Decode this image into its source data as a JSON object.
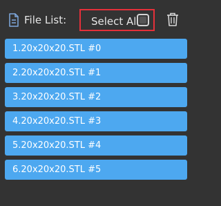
{
  "header": {
    "title": "File List:",
    "file_icon": "file-text-icon",
    "select_all_label": "Select All",
    "select_all_checked": false,
    "delete_icon": "trash-icon"
  },
  "files": [
    {
      "label": "1.20x20x20.STL #0"
    },
    {
      "label": "2.20x20x20.STL #1"
    },
    {
      "label": "3.20x20x20.STL #2"
    },
    {
      "label": "4.20x20x20.STL #3"
    },
    {
      "label": "5.20x20x20.STL #4"
    },
    {
      "label": "6.20x20x20.STL #5"
    }
  ],
  "colors": {
    "background": "#333333",
    "item_fill": "#4da8f0",
    "highlight_border": "#e5303a",
    "text": "#e6e6e6"
  }
}
